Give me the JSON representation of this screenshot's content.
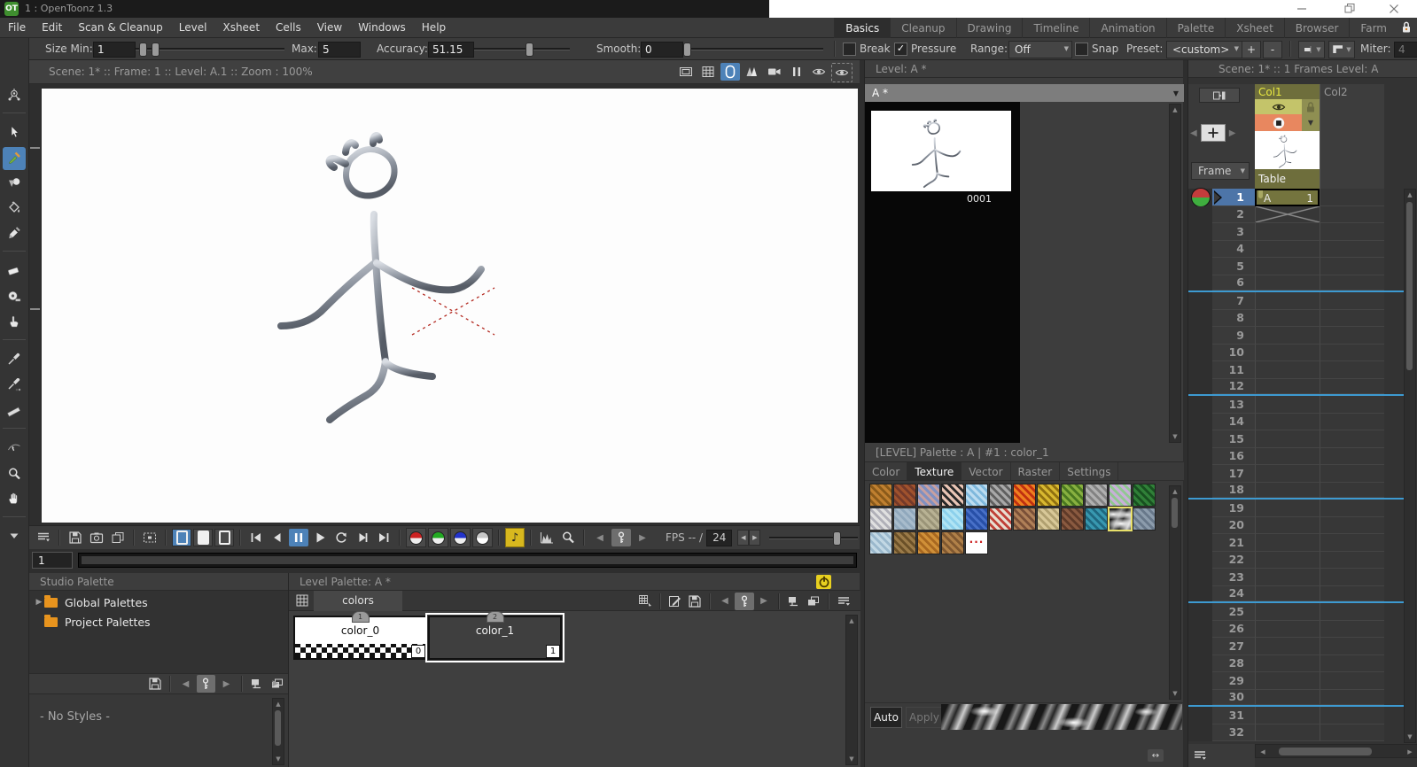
{
  "title_bar": {
    "logo": "OT",
    "app_title": "1 : OpenToonz 1.3"
  },
  "menu_bar": {
    "menus": [
      "File",
      "Edit",
      "Scan & Cleanup",
      "Level",
      "Xsheet",
      "Cells",
      "View",
      "Windows",
      "Help"
    ],
    "workspace_tabs": [
      {
        "label": "Basics",
        "active": true
      },
      {
        "label": "Cleanup"
      },
      {
        "label": "Drawing"
      },
      {
        "label": "Timeline"
      },
      {
        "label": "Animation"
      },
      {
        "label": "Palette"
      },
      {
        "label": "Xsheet"
      },
      {
        "label": "Browser"
      },
      {
        "label": "Farm"
      }
    ]
  },
  "options": {
    "size_min_label": "Size Min:",
    "size_min": "1",
    "max_label": "Max:",
    "max": "5",
    "accuracy_label": "Accuracy:",
    "accuracy": "51.15",
    "smooth_label": "Smooth:",
    "smooth": "0",
    "break_label": "Break",
    "pressure_label": "Pressure",
    "range_label": "Range:",
    "range_value": "Off",
    "snap_label": "Snap",
    "preset_label": "Preset:",
    "preset_value": "<custom>",
    "plus_label": "+",
    "minus_label": "-",
    "miter_label": "Miter:",
    "miter_value": "4"
  },
  "tools": [
    {
      "name": "animate-tool",
      "icon": "animate"
    },
    {
      "name": "selection-tool",
      "icon": "cursor",
      "sep": true
    },
    {
      "name": "brush-tool",
      "icon": "brush",
      "active": true
    },
    {
      "name": "geometric-tool",
      "icon": "shapes"
    },
    {
      "name": "fill-tool",
      "icon": "bucket"
    },
    {
      "name": "paint-brush-tool",
      "icon": "flatbrush"
    },
    {
      "name": "eraser-tool",
      "icon": "eraser",
      "sep": true
    },
    {
      "name": "tape-tool",
      "icon": "tape"
    },
    {
      "name": "finger-tool",
      "icon": "finger"
    },
    {
      "name": "style-picker-tool",
      "icon": "dropper",
      "sep": true
    },
    {
      "name": "rgb-picker-tool",
      "icon": "dropper2"
    },
    {
      "name": "ruler-tool",
      "icon": "ruler"
    },
    {
      "name": "control-point-editor-tool",
      "icon": "cpedit",
      "sep": true
    },
    {
      "name": "zoom-tool",
      "icon": "magnifier"
    },
    {
      "name": "hand-tool",
      "icon": "hand"
    },
    {
      "name": "more-tools",
      "icon": "chevdown",
      "sep": true
    }
  ],
  "viewer": {
    "title": "Scene: 1*   ::   Frame: 1   ::   Level: A.1   ::   Zoom : 100%",
    "frame_value": "1",
    "fps_label": "FPS -- /",
    "fps_value": "24"
  },
  "studio_palette": {
    "header": "Studio Palette",
    "folders": [
      "Global Palettes",
      "Project Palettes"
    ],
    "empty_label": "- No Styles -"
  },
  "level_palette": {
    "header": "Level Palette: A *",
    "page_tab": "colors",
    "swatches": [
      {
        "name": "color_0",
        "tab": "1",
        "index": "0",
        "kind": "checker"
      },
      {
        "name": "color_1",
        "tab": "2",
        "index": "1",
        "kind": "smoke",
        "selected": true
      }
    ]
  },
  "level_strip": {
    "header": "Level:  A *",
    "selector": "A *",
    "frame_number": "0001"
  },
  "palette_panel": {
    "header": "[LEVEL]  Palette : A | #1 : color_1",
    "tabs": [
      {
        "label": "Color"
      },
      {
        "label": "Texture",
        "active": true
      },
      {
        "label": "Vector"
      },
      {
        "label": "Raster"
      },
      {
        "label": "Settings"
      }
    ],
    "auto_label": "Auto",
    "apply_label": "Apply",
    "textures": [
      {
        "c1": "#c08030",
        "c2": "#8a5a1a"
      },
      {
        "c1": "#a0522d",
        "c2": "#743a2a"
      },
      {
        "c1": "#8090c0",
        "c2": "#c8a0a0"
      },
      {
        "c1": "#e8c4b4",
        "c2": "#282828"
      },
      {
        "c1": "#bcdcf0",
        "c2": "#7fb8dc"
      },
      {
        "c1": "#a8a8a8",
        "c2": "#606060"
      },
      {
        "c1": "#f08020",
        "c2": "#c03010"
      },
      {
        "c1": "#d8b830",
        "c2": "#907010"
      },
      {
        "c1": "#88b040",
        "c2": "#4a7820"
      },
      {
        "c1": "#b0b0b0",
        "c2": "#828282"
      },
      {
        "c1": "#c8b0d8",
        "c2": "#90c890"
      },
      {
        "c1": "#308038",
        "c2": "#185020"
      },
      {
        "c1": "#e0e0e0",
        "c2": "#b0b0b8"
      },
      {
        "c1": "#a8bccc",
        "c2": "#90a8bc"
      },
      {
        "c1": "#b8b294",
        "c2": "#9a9478"
      },
      {
        "c1": "#b0e4f4",
        "c2": "#8cd0ec"
      },
      {
        "c1": "#2850a8",
        "c2": "#4870c8"
      },
      {
        "c1": "#e8ddd0",
        "c2": "#c04038"
      },
      {
        "c1": "#b08058",
        "c2": "#7a5038"
      },
      {
        "c1": "#d8c898",
        "c2": "#b0a070"
      },
      {
        "c1": "#8a5a40",
        "c2": "#5f3a28"
      },
      {
        "c1": "#3898b0",
        "c2": "#1f6880"
      },
      {
        "kind": "smoke",
        "selected": true
      },
      {
        "c1": "#8c9cac",
        "c2": "#68788a"
      },
      {
        "c1": "#c2d8e4",
        "c2": "#9ab8cc"
      },
      {
        "c1": "#9a7a48",
        "c2": "#6a5028"
      },
      {
        "c1": "#d09038",
        "c2": "#a86820"
      },
      {
        "c1": "#b08048",
        "c2": "#805830"
      },
      {
        "kind": "dots",
        "label": "..."
      }
    ]
  },
  "xsheet": {
    "header": "Scene: 1*   ::   1 Frames  Level: A",
    "col1_label": "Col1",
    "col2_label": "Col2",
    "table_label": "Table",
    "frame_mode": "Frame",
    "frames": [
      1,
      2,
      3,
      4,
      5,
      6,
      7,
      8,
      9,
      10,
      11,
      12,
      13,
      14,
      15,
      16,
      17,
      18,
      19,
      20,
      21,
      22,
      23,
      24,
      25,
      26,
      27,
      28,
      29,
      30,
      31,
      32
    ],
    "key_cell": {
      "level": "A",
      "frame": "1"
    },
    "marker_rows": [
      6,
      12,
      18,
      24,
      30
    ]
  }
}
